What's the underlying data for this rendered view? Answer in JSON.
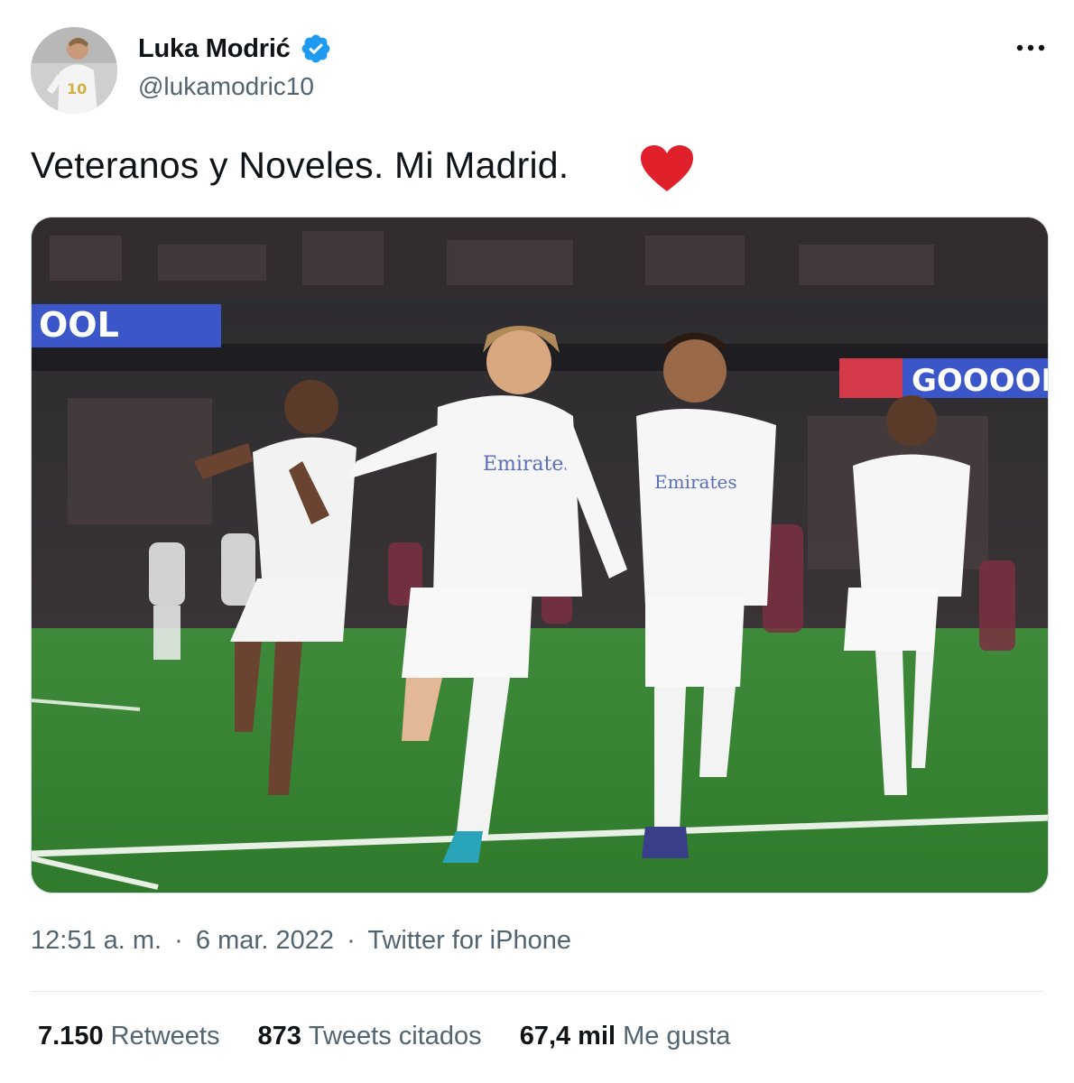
{
  "author": {
    "name": "Luka Modrić",
    "handle": "@lukamodric10",
    "verified": true
  },
  "tweet": {
    "text": "Veteranos y Noveles. Mi Madrid.",
    "emoji": "red-heart-icon"
  },
  "media": {
    "board_left_text": "OOL",
    "board_right_text": "GOOOOL"
  },
  "meta": {
    "time": "12:51 a. m.",
    "date": "6 mar. 2022",
    "source": "Twitter for iPhone",
    "separator": "·"
  },
  "stats": {
    "retweets": {
      "value": "7.150",
      "label": "Retweets"
    },
    "quotes": {
      "value": "873",
      "label": "Tweets citados"
    },
    "likes": {
      "value": "67,4 mil",
      "label": "Me gusta"
    }
  },
  "colors": {
    "verified_blue": "#1d9bf0",
    "secondary_text": "#536471",
    "primary_text": "#0f1419",
    "heart_red": "#e0212c"
  }
}
